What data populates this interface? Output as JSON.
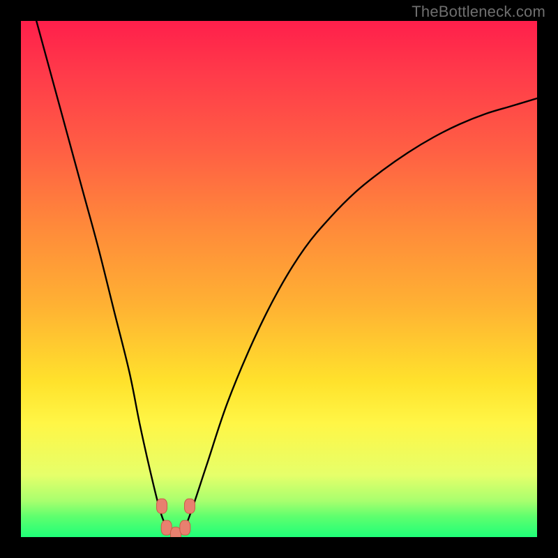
{
  "watermark": "TheBottleneck.com",
  "colors": {
    "page_bg": "#000000",
    "watermark": "#6f6f6f",
    "curve": "#000000",
    "marker_fill": "#e8806f",
    "marker_stroke": "#c95b47",
    "gradient_stops": [
      "#ff1f4b",
      "#ff3a4a",
      "#ff5f44",
      "#ff8a3a",
      "#ffb133",
      "#ffe22c",
      "#fff646",
      "#e6ff6a",
      "#a8ff6e",
      "#5fff6e",
      "#1fff78"
    ]
  },
  "chart_data": {
    "type": "line",
    "title": "",
    "xlabel": "",
    "ylabel": "",
    "xlim": [
      0,
      100
    ],
    "ylim": [
      0,
      100
    ],
    "grid": false,
    "legend": false,
    "series": [
      {
        "name": "bottleneck-curve",
        "x": [
          3,
          6,
          9,
          12,
          15,
          18,
          21,
          23,
          25,
          27,
          28.5,
          30,
          31.5,
          33,
          36,
          40,
          45,
          50,
          55,
          60,
          65,
          70,
          75,
          80,
          85,
          90,
          95,
          100
        ],
        "y": [
          100,
          89,
          78,
          67,
          56,
          44,
          32,
          22,
          13,
          5,
          1.5,
          0.2,
          1.5,
          5,
          14,
          26,
          38,
          48,
          56,
          62,
          67,
          71,
          74.5,
          77.5,
          80,
          82,
          83.5,
          85
        ]
      }
    ],
    "annotations": [
      {
        "name": "marker-left-top",
        "x": 27.3,
        "y": 6.0
      },
      {
        "name": "marker-left-bot",
        "x": 28.2,
        "y": 1.8
      },
      {
        "name": "marker-mid-bot",
        "x": 30.0,
        "y": 0.5
      },
      {
        "name": "marker-right-bot",
        "x": 31.8,
        "y": 1.8
      },
      {
        "name": "marker-right-top",
        "x": 32.7,
        "y": 6.0
      }
    ]
  }
}
